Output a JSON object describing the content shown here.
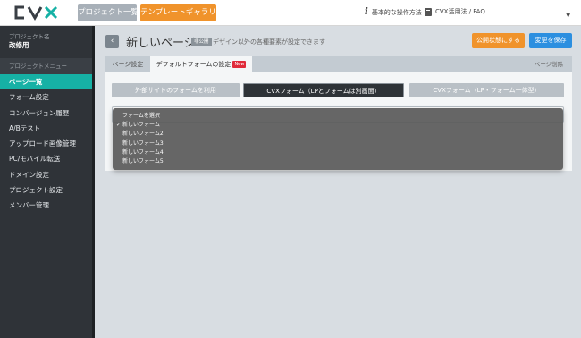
{
  "header": {
    "logo_text": "CVX",
    "nav": [
      {
        "label": "プロジェクト一覧"
      },
      {
        "label": "テンプレートギャラリー"
      }
    ],
    "help_link": "基本的な操作方法",
    "faq_link": "CVX活用法 / FAQ"
  },
  "sidebar": {
    "project_label": "プロジェクト名",
    "project_name": "改修用",
    "menu_header": "プロジェクトメニュー",
    "items": [
      {
        "label": "ページ一覧",
        "active": true
      },
      {
        "label": "フォーム設定"
      },
      {
        "label": "コンバージョン履歴"
      },
      {
        "label": "A/Bテスト"
      },
      {
        "label": "アップロード画像管理"
      },
      {
        "label": "PC/モバイル転送"
      },
      {
        "label": "ドメイン設定"
      },
      {
        "label": "プロジェクト設定"
      },
      {
        "label": "メンバー管理"
      }
    ]
  },
  "main": {
    "title": "新しいページ",
    "hint_badge": "非公開",
    "hint_text": "デザイン以外の各種要素が設定できます",
    "publish_label": "公開状態にする",
    "save_label": "変更を保存",
    "tabs": [
      {
        "label": "ページ設定"
      },
      {
        "label": "デフォルトフォームの設定",
        "badge": "New"
      }
    ],
    "delete_label": "ページ削除",
    "form_options": [
      {
        "label": "外部サイトのフォームを利用"
      },
      {
        "label": "CVXフォーム（LPとフォームは別画面）",
        "selected": true
      },
      {
        "label": "CVXフォーム（LP・フォーム一体型）"
      }
    ]
  },
  "dropdown": {
    "options": [
      {
        "label": "フォームを選択"
      },
      {
        "label": "新しいフォーム",
        "checked": true
      },
      {
        "label": "新しいフォーム2"
      },
      {
        "label": "新しいフォーム3"
      },
      {
        "label": "新しいフォーム4"
      },
      {
        "label": "新しいフォーム5"
      }
    ],
    "check_glyph": "✓"
  },
  "colors": {
    "accent_teal": "#16b1a5",
    "orange": "#f0932b",
    "blue": "#2c8fe0",
    "sidebar_bg": "#2f3338",
    "new_badge": "#e02a3a"
  },
  "icons": {
    "back": "chevron-left-icon",
    "help": "info-icon",
    "faq": "book-icon",
    "user": "caret-down-icon"
  }
}
